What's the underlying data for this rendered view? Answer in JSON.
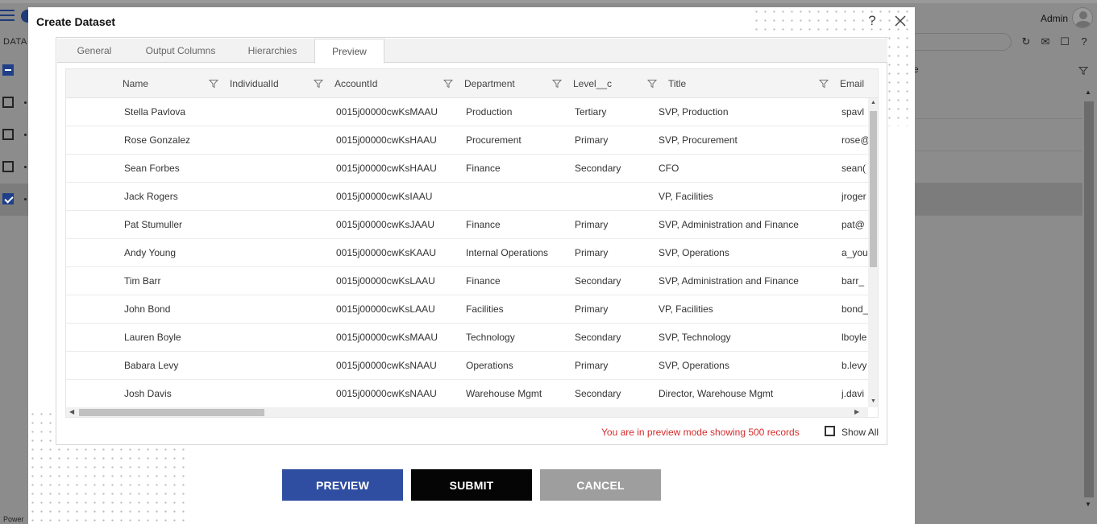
{
  "background": {
    "header_label": "DATA",
    "admin": "Admin",
    "grid_header_fragment": "e",
    "footer": "Power",
    "tool_icons": [
      "↻",
      "✉",
      "☐",
      "?"
    ]
  },
  "modal": {
    "title": "Create Dataset",
    "help": "?",
    "tabs": [
      {
        "label": "General"
      },
      {
        "label": "Output Columns"
      },
      {
        "label": "Hierarchies"
      },
      {
        "label": "Preview"
      }
    ],
    "active_tab": "Preview",
    "columns": [
      {
        "label": "Name"
      },
      {
        "label": "IndividualId"
      },
      {
        "label": "AccountId"
      },
      {
        "label": "Department"
      },
      {
        "label": "Level__c"
      },
      {
        "label": "Title"
      },
      {
        "label": "Email"
      }
    ],
    "rows": [
      [
        "Stella Pavlova",
        "",
        "0015j00000cwKsMAAU",
        "Production",
        "Tertiary",
        "SVP, Production",
        "spavl"
      ],
      [
        "Rose Gonzalez",
        "",
        "0015j00000cwKsHAAU",
        "Procurement",
        "Primary",
        "SVP, Procurement",
        "rose@"
      ],
      [
        "Sean Forbes",
        "",
        "0015j00000cwKsHAAU",
        "Finance",
        "Secondary",
        "CFO",
        "sean("
      ],
      [
        "Jack Rogers",
        "",
        "0015j00000cwKsIAAU",
        "",
        "",
        "VP, Facilities",
        "jroger"
      ],
      [
        "Pat Stumuller",
        "",
        "0015j00000cwKsJAAU",
        "Finance",
        "Primary",
        "SVP, Administration and Finance",
        "pat@"
      ],
      [
        "Andy Young",
        "",
        "0015j00000cwKsKAAU",
        "Internal Operations",
        "Primary",
        "SVP, Operations",
        "a_you"
      ],
      [
        "Tim Barr",
        "",
        "0015j00000cwKsLAAU",
        "Finance",
        "Secondary",
        "SVP, Administration and Finance",
        "barr_"
      ],
      [
        "John Bond",
        "",
        "0015j00000cwKsLAAU",
        "Facilities",
        "Primary",
        "VP, Facilities",
        "bond_"
      ],
      [
        "Lauren Boyle",
        "",
        "0015j00000cwKsMAAU",
        "Technology",
        "Secondary",
        "SVP, Technology",
        "lboyle"
      ],
      [
        "Babara Levy",
        "",
        "0015j00000cwKsNAAU",
        "Operations",
        "Primary",
        "SVP, Operations",
        "b.levy"
      ],
      [
        "Josh Davis",
        "",
        "0015j00000cwKsNAAU",
        "Warehouse Mgmt",
        "Secondary",
        "Director, Warehouse Mgmt",
        "j.davi"
      ]
    ],
    "preview_note": "You are in preview mode showing 500 records",
    "show_all_label": "Show All",
    "buttons": {
      "preview": "PREVIEW",
      "submit": "SUBMIT",
      "cancel": "CANCEL"
    }
  },
  "colors": {
    "primary_button": "#2f4ea1",
    "submit_button": "#050505",
    "cancel_button": "#9e9e9e",
    "note_text": "#d52b2b",
    "brand": "#1e3a78"
  }
}
